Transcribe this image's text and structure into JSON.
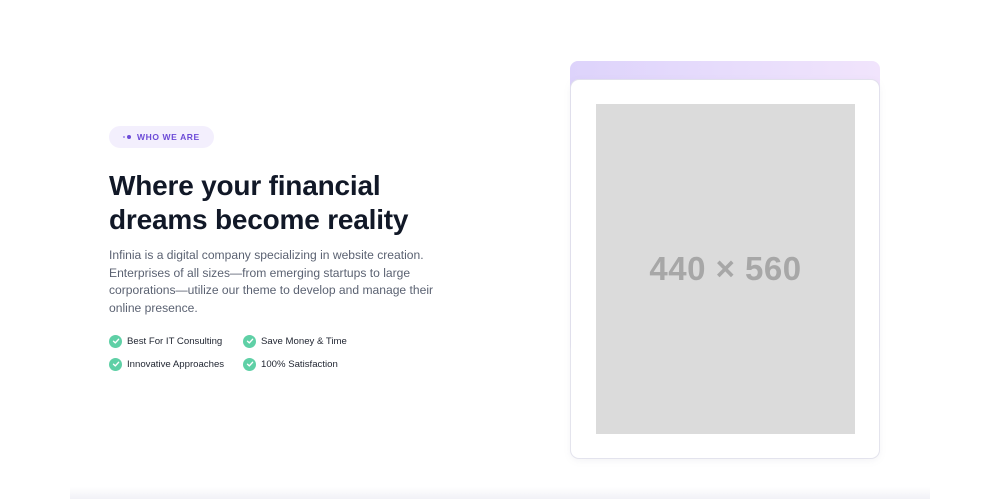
{
  "badge": {
    "label": "WHO WE ARE",
    "icon": "dots-icon",
    "color": "#6c4bd7",
    "background": "#f3effd"
  },
  "headline": {
    "line1": "Where your financial",
    "line2": "dreams become reality"
  },
  "description": "Infinia is a digital company specializing in website creation. Enterprises of all sizes—from emerging startups to large corporations—utilize our theme to develop and manage their online presence.",
  "features": [
    {
      "label": "Best For IT Consulting",
      "icon": "check-circle-icon"
    },
    {
      "label": "Save Money & Time",
      "icon": "check-circle-icon"
    },
    {
      "label": "Innovative Approaches",
      "icon": "check-circle-icon"
    },
    {
      "label": "100% Satisfaction",
      "icon": "check-circle-icon"
    }
  ],
  "image_placeholder": {
    "text": "440 × 560"
  },
  "colors": {
    "heading": "#111827",
    "body_text": "#5b6272",
    "check_green": "#5fd0a6",
    "card_gradient_start": "#ddd3fb",
    "card_gradient_end": "#f1e4fc",
    "placeholder_bg": "#dbdbdb"
  }
}
